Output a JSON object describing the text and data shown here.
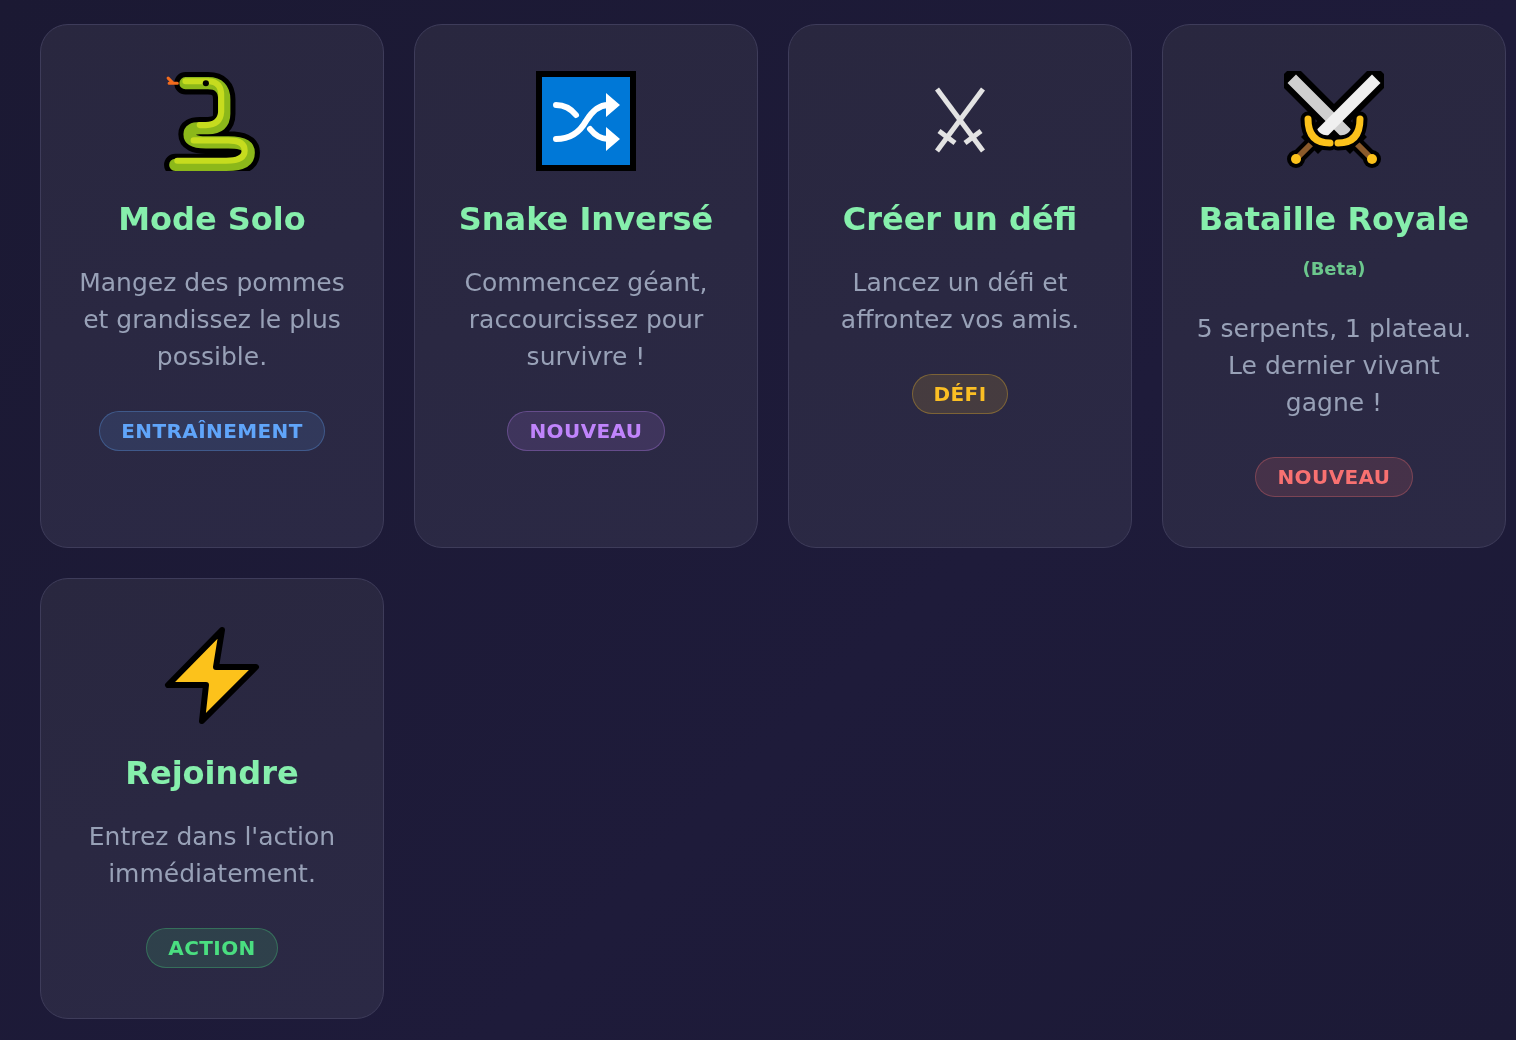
{
  "cards": [
    {
      "kind": "solo",
      "title": "Mode Solo",
      "description": "Mangez des pommes et grandissez le plus possible.",
      "badge": {
        "label": "ENTRAÎNEMENT",
        "color": "#60a5fa"
      }
    },
    {
      "kind": "reverse",
      "title": "Snake Inversé",
      "description": "Commencez géant, raccourcissez pour survivre !",
      "badge": {
        "label": "NOUVEAU",
        "color": "#c084fc"
      }
    },
    {
      "kind": "challenge",
      "title": "Créer un défi",
      "description": "Lancez un défi et affrontez vos amis.",
      "badge": {
        "label": "DÉFI",
        "color": "#fbbf24"
      }
    },
    {
      "kind": "battle",
      "title": "Bataille Royale",
      "subtitle": "(Beta)",
      "description": "5 serpents, 1 plateau. Le dernier vivant gagne !",
      "badge": {
        "label": "NOUVEAU",
        "color": "#f87171"
      }
    },
    {
      "kind": "join",
      "title": "Rejoindre",
      "description": "Entrez dans l'action immédiatement.",
      "badge": {
        "label": "ACTION",
        "color": "#4ade80"
      }
    }
  ]
}
